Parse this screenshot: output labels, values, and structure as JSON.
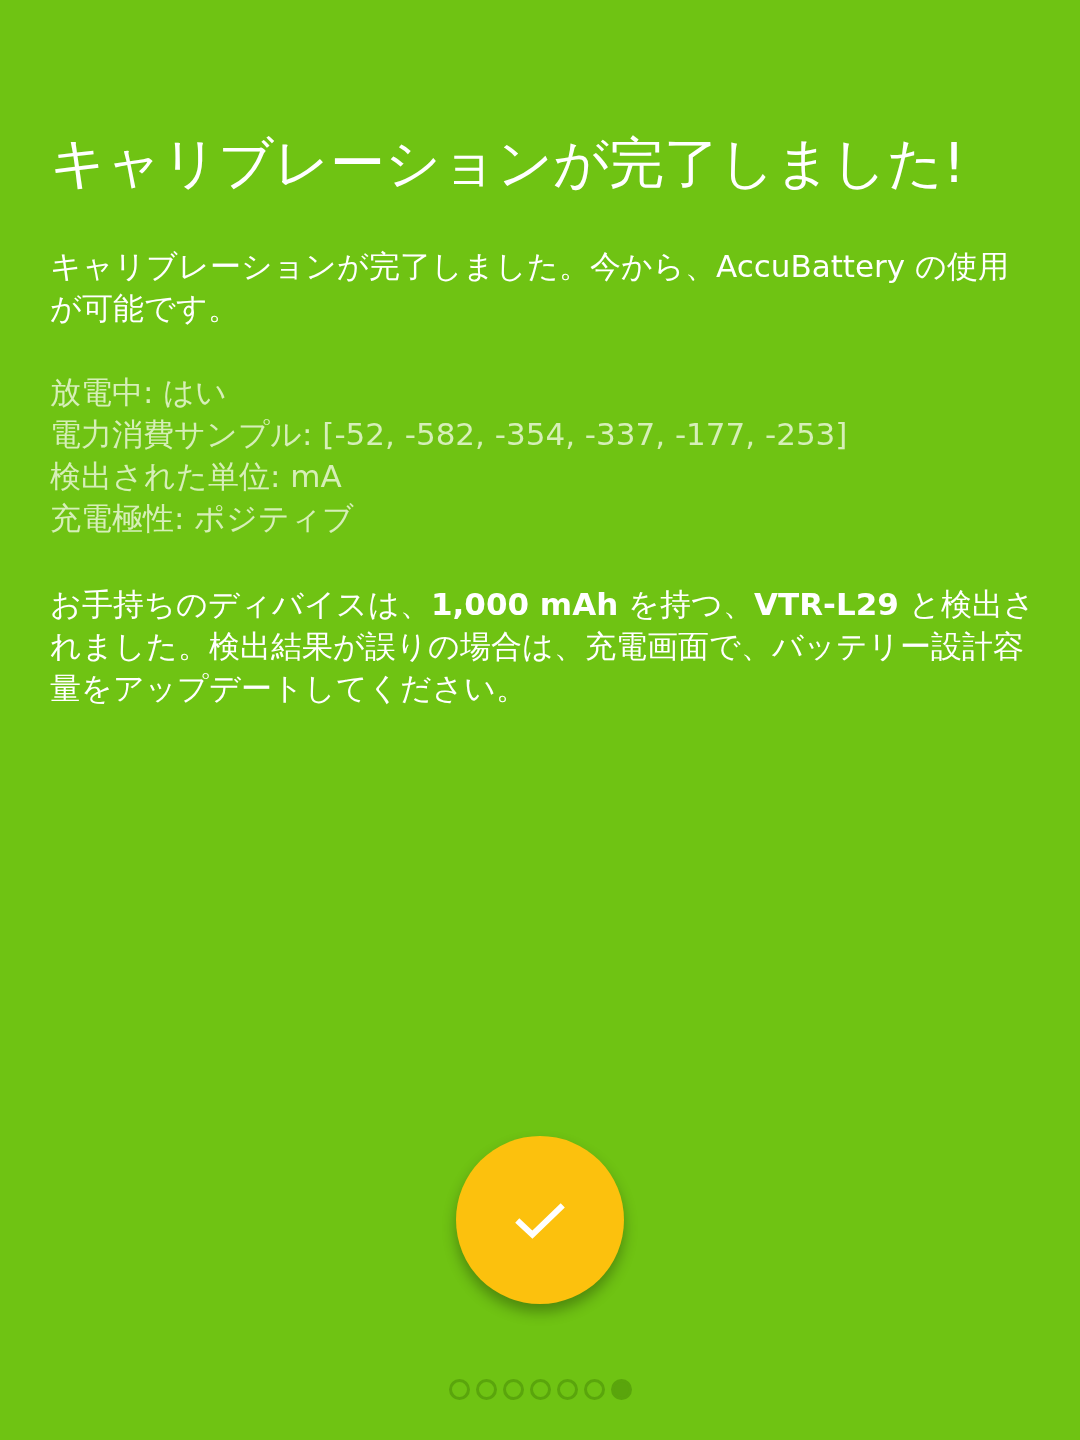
{
  "title": "キャリブレーションが完了しました!",
  "message": "キャリブレーションが完了しました。今から、AccuBattery の使用が可能です。",
  "details": [
    "放電中: はい",
    "電力消費サンプル: [-52, -582, -354, -337, -177, -253]",
    "検出された単位: mA",
    "充電極性: ポジティブ"
  ],
  "result": "お手持ちのディバイスは、**1,000 mAh** を持つ、**VTR-L29** と検出されました。検出結果が誤りの場合は、充電画面で、バッテリー設計容量をアップデートしてください。",
  "pages": [
    {
      "selected": false
    },
    {
      "selected": false
    },
    {
      "selected": false
    },
    {
      "selected": false
    },
    {
      "selected": false
    },
    {
      "selected": false
    },
    {
      "selected": true
    }
  ]
}
